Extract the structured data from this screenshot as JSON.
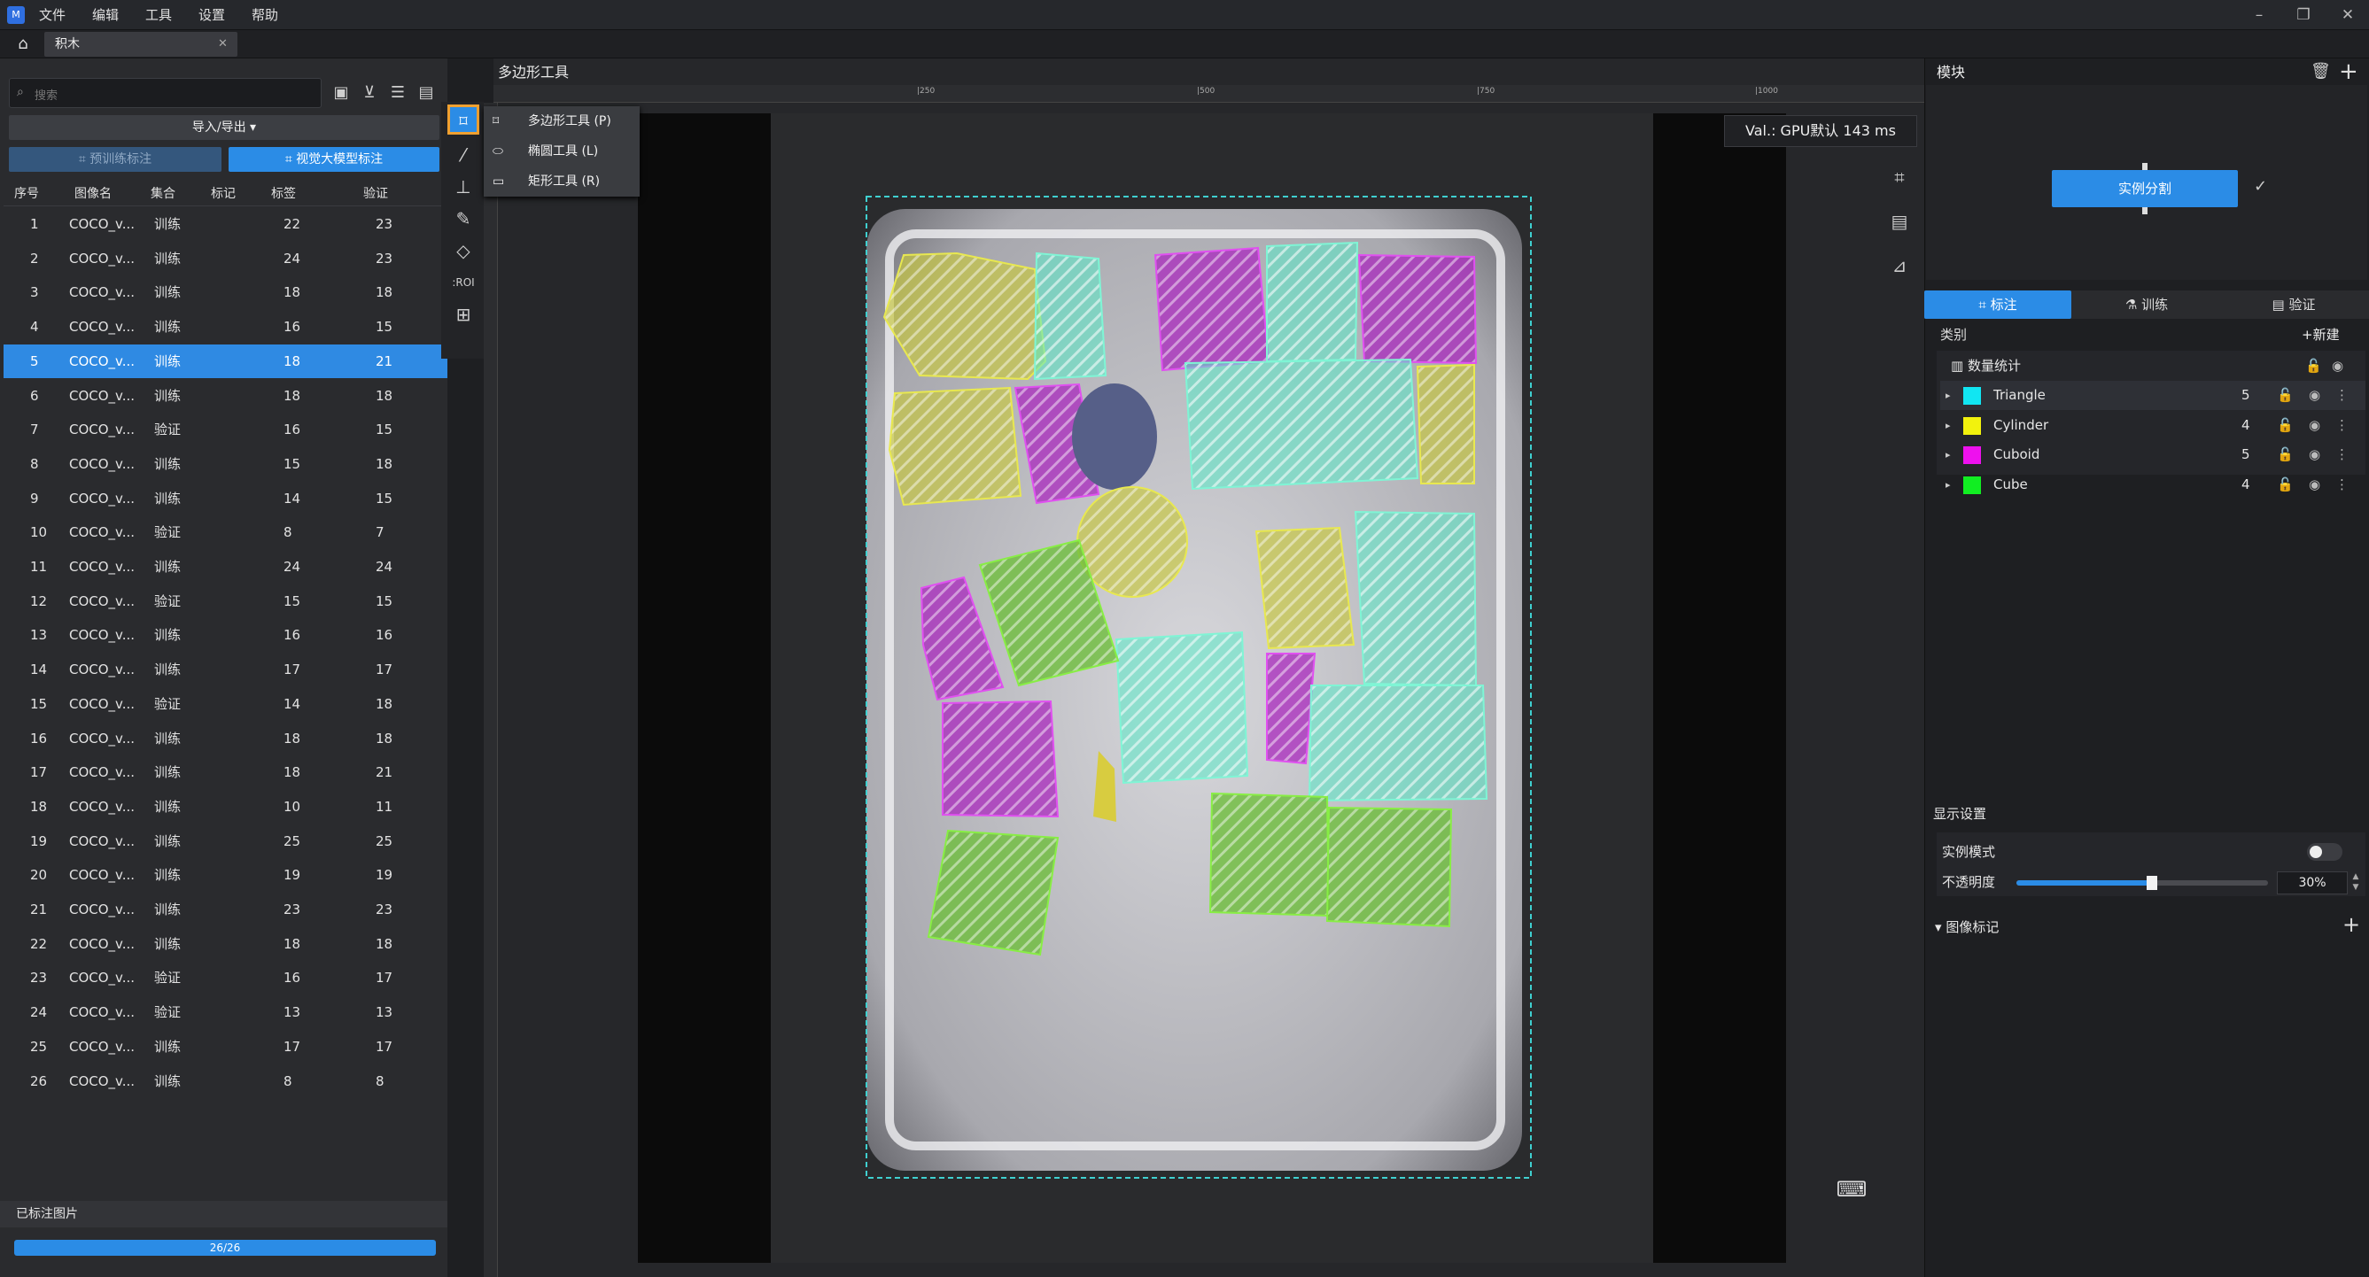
{
  "menu": {
    "items": [
      "文件",
      "编辑",
      "工具",
      "设置",
      "帮助"
    ]
  },
  "tab": {
    "label": "积木"
  },
  "left": {
    "search_placeholder": "搜索",
    "import_export": "导入/导出 ▾",
    "pretrain_label": "预训练标注",
    "vlm_label": "视觉大模型标注",
    "headers": [
      "序号",
      "图像名",
      "集合",
      "标记",
      "标签",
      "验证"
    ],
    "rows": [
      [
        "1",
        "COCO_v...",
        "训练",
        "22",
        "23"
      ],
      [
        "2",
        "COCO_v...",
        "训练",
        "24",
        "23"
      ],
      [
        "3",
        "COCO_v...",
        "训练",
        "18",
        "18"
      ],
      [
        "4",
        "COCO_v...",
        "训练",
        "16",
        "15"
      ],
      [
        "5",
        "COCO_v...",
        "训练",
        "18",
        "21"
      ],
      [
        "6",
        "COCO_v...",
        "训练",
        "18",
        "18"
      ],
      [
        "7",
        "COCO_v...",
        "验证",
        "16",
        "15"
      ],
      [
        "8",
        "COCO_v...",
        "训练",
        "15",
        "18"
      ],
      [
        "9",
        "COCO_v...",
        "训练",
        "14",
        "15"
      ],
      [
        "10",
        "COCO_v...",
        "验证",
        "8",
        "7"
      ],
      [
        "11",
        "COCO_v...",
        "训练",
        "24",
        "24"
      ],
      [
        "12",
        "COCO_v...",
        "验证",
        "15",
        "15"
      ],
      [
        "13",
        "COCO_v...",
        "训练",
        "16",
        "16"
      ],
      [
        "14",
        "COCO_v...",
        "训练",
        "17",
        "17"
      ],
      [
        "15",
        "COCO_v...",
        "验证",
        "14",
        "18"
      ],
      [
        "16",
        "COCO_v...",
        "训练",
        "18",
        "18"
      ],
      [
        "17",
        "COCO_v...",
        "训练",
        "18",
        "21"
      ],
      [
        "18",
        "COCO_v...",
        "训练",
        "10",
        "11"
      ],
      [
        "19",
        "COCO_v...",
        "训练",
        "25",
        "25"
      ],
      [
        "20",
        "COCO_v...",
        "训练",
        "19",
        "19"
      ],
      [
        "21",
        "COCO_v...",
        "训练",
        "23",
        "23"
      ],
      [
        "22",
        "COCO_v...",
        "训练",
        "18",
        "18"
      ],
      [
        "23",
        "COCO_v...",
        "验证",
        "16",
        "17"
      ],
      [
        "24",
        "COCO_v...",
        "验证",
        "13",
        "13"
      ],
      [
        "25",
        "COCO_v...",
        "训练",
        "17",
        "17"
      ],
      [
        "26",
        "COCO_v...",
        "训练",
        "8",
        "8"
      ]
    ],
    "selected_row": 4,
    "labeled_title": "已标注图片",
    "progress_text": "26/26",
    "progress_fraction": 1.0
  },
  "tool_menu": {
    "title": "多边形工具",
    "items": [
      "多边形工具 (P)",
      "椭圆工具 (L)",
      "矩形工具 (R)"
    ],
    "roi_label": ":ROI"
  },
  "ruler": {
    "ticks": [
      "|250",
      "|500",
      "|750",
      "|1000"
    ]
  },
  "canvas": {
    "val_text": "Val.: GPU默认 143 ms"
  },
  "right": {
    "module_title": "模块",
    "module_node": "实例分割",
    "tabs": [
      "标注",
      "训练",
      "验证"
    ],
    "category_title": "类别",
    "new_label": "新建",
    "stats_label": "数量统计",
    "categories": [
      {
        "name": "Triangle",
        "count": "5",
        "color": "#11e6f2"
      },
      {
        "name": "Cylinder",
        "count": "4",
        "color": "#f2f20d"
      },
      {
        "name": "Cuboid",
        "count": "5",
        "color": "#ee11ee"
      },
      {
        "name": "Cube",
        "count": "4",
        "color": "#11ee22"
      }
    ],
    "display_title": "显示设置",
    "instance_mode": "实例模式",
    "opacity_label": "不透明度",
    "opacity_value": "30%",
    "opacity_fraction": 0.3,
    "image_tags": "图像标记"
  }
}
